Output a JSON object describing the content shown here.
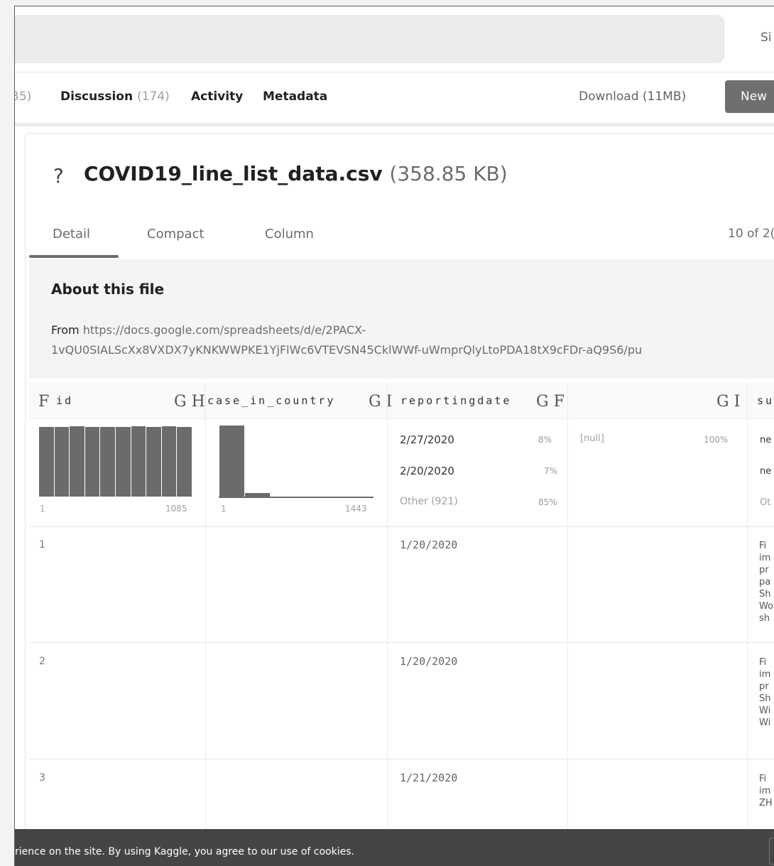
{
  "header": {
    "signin": "Si"
  },
  "nav": {
    "tabs": [
      {
        "label": "",
        "count": "35)"
      },
      {
        "label": "Discussion",
        "count": "(174)"
      },
      {
        "label": "Activity"
      },
      {
        "label": "Metadata"
      }
    ],
    "download": "Download (11MB)",
    "new_button": "New"
  },
  "file": {
    "icon": "?",
    "name": "COVID19_line_list_data.csv",
    "size": "(358.85 KB)"
  },
  "view_tabs": [
    "Detail",
    "Compact",
    "Column"
  ],
  "column_count": "10 of 2(",
  "about": {
    "title": "About this file",
    "from_label": "From",
    "line1": " https://docs.google.com/spreadsheets/d/e/2PACX-",
    "line2": "1vQU0SIALScXx8VXDX7yKNKWWPKE1YjFlWc6VTEVSN45CklWWf-uWmprQlyLtoPDA18tX9cFDr-aQ9S6/pu"
  },
  "table": {
    "columns": [
      {
        "type_icon": "F",
        "name": "id",
        "after_icons": "G H"
      },
      {
        "type_icon": "",
        "name": "case_in_country",
        "after_icons": "G I"
      },
      {
        "type_icon": "",
        "name": "reportingdate",
        "after_icons": "G F"
      },
      {
        "type_icon": "",
        "name": "",
        "after_icons": "G I"
      },
      {
        "type_icon": "",
        "name": "su"
      }
    ],
    "id_hist": {
      "min": "1",
      "max": "1085",
      "bars": [
        0.98,
        0.98,
        0.99,
        0.98,
        0.98,
        0.98,
        0.99,
        0.98,
        0.99,
        0.98
      ]
    },
    "case_hist": {
      "min": "1",
      "max": "1443",
      "bars": [
        1.0,
        0.05,
        0.02,
        0.02,
        0.02,
        0.02
      ]
    },
    "reportingdate_stats": [
      {
        "value": "2/27/2020",
        "pct": "8%"
      },
      {
        "value": "2/20/2020",
        "pct": "7%"
      },
      {
        "value": "Other (921)",
        "pct": "85%"
      }
    ],
    "col4_stats": [
      {
        "value": "[null]",
        "pct": "100%"
      }
    ],
    "col5_stats": [
      "ne",
      "ne",
      "Ot"
    ],
    "rows": [
      {
        "id": "1",
        "reportingdate": "1/20/2020",
        "summary": "Fi im pr pa Sh Wo sh"
      },
      {
        "id": "2",
        "reportingdate": "1/20/2020",
        "summary": "Fi im pr Sh Wi Wi"
      },
      {
        "id": "3",
        "reportingdate": "1/21/2020",
        "summary": "Fi im ZH"
      }
    ]
  },
  "cookie": {
    "text": "rience on the site. By using Kaggle, you agree to our use of cookies."
  }
}
